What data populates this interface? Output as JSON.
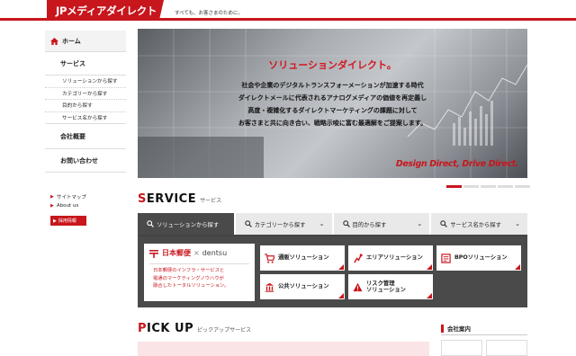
{
  "header": {
    "logo": "JPメディアダイレクト",
    "tagline": "すべても、お客さまのために。"
  },
  "sidebar": {
    "home": "ホーム",
    "services": "サービス",
    "service_items": [
      "ソリューションから探す",
      "カテゴリーから探す",
      "目的から探す",
      "サービス名から探す"
    ],
    "company": "会社概要",
    "contact": "お問い合わせ",
    "small_links": [
      "サイトマップ",
      "About us"
    ],
    "recruit": "採用情報"
  },
  "hero": {
    "title": "ソリューションダイレクト。",
    "lines": [
      "社会や企業のデジタルトランスフォーメーションが加速する時代",
      "ダイレクトメールに代表されるアナログメディアの価値を再定義し",
      "高度・複雑化するダイレクトマーケティングの課題に対して",
      "お客さまと共に向き合い、戦略示唆に富む最適解をご提案します。"
    ],
    "tagline_design": "Design Direct,",
    "tagline_drive": "Drive Direct.",
    "slide_count": 5,
    "active_slide": 1
  },
  "service": {
    "heading": "ERVICE",
    "heading_first": "S",
    "subheading": "サービス",
    "tabs": [
      "ソリューションから探す",
      "カテゴリーから探す",
      "目的から探す",
      "サービス名から探す"
    ],
    "active_tab": 0,
    "brand_jp": "日本郵便",
    "brand_x": "×",
    "brand_dentsu": "dentsu",
    "brand_desc": [
      "日本郵便のインフラ・サービスと",
      "電通のマーケティングノウハウが",
      "融合したトータルソリューション。"
    ],
    "buttons": [
      "通販ソリューション",
      "エリアソリューション",
      "BPOソリューション",
      "公共ソリューション",
      "リスク管理\nソリューション"
    ]
  },
  "pickup": {
    "heading_first": "P",
    "heading": "ICK UP",
    "subheading": "ピックアップサービス"
  },
  "company_box": {
    "heading": "会社案内"
  },
  "colors": {
    "accent": "#c8161d",
    "dark_panel": "#4a4a4a",
    "tab_bg": "#e9e9e9"
  }
}
